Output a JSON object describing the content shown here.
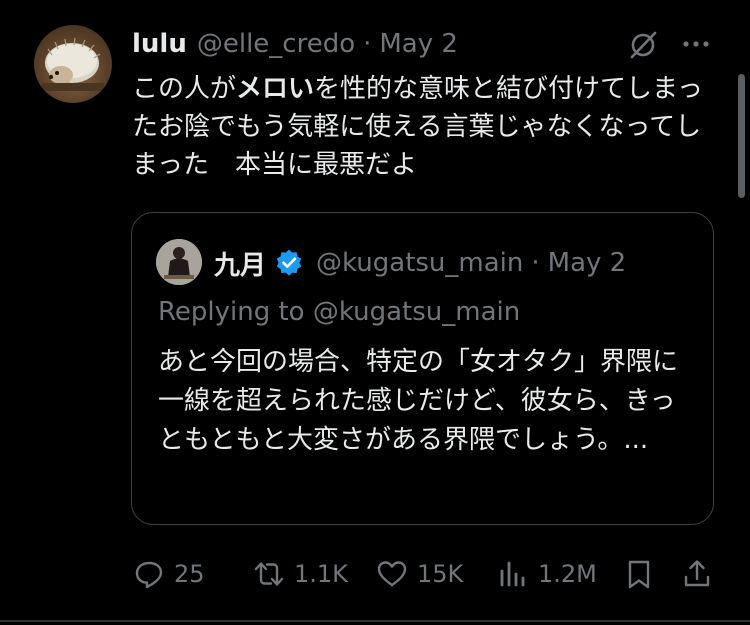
{
  "tweet": {
    "author_name": "lulu",
    "handle": "@elle_credo",
    "separator": "·",
    "date": "May 2",
    "text_parts": [
      "この人が",
      "メロい",
      "を性的な意味と結び付けてしまったお陰でもう気軽に使える言葉じゃなくなってしまった　本当に最悪だよ"
    ]
  },
  "quoted_tweet": {
    "author_name": "九月",
    "handle": "@kugatsu_main",
    "separator": "·",
    "date": "May 2",
    "replying_to": "Replying to @kugatsu_main",
    "text": "あと今回の場合、特定の「女オタク」界隈に一線を超えられた感じだけど、彼女ら、きっともともと大変さがある界隈でしょう。..."
  },
  "actions": {
    "replies": "25",
    "reposts": "1.1K",
    "likes": "15K",
    "views": "1.2M"
  },
  "icons": {
    "grok": "grok-icon",
    "more": "more-icon",
    "verified": "verified-icon",
    "reply": "reply-icon",
    "repost": "repost-icon",
    "like": "heart-icon",
    "views": "views-icon",
    "bookmark": "bookmark-icon",
    "share": "share-icon"
  },
  "colors": {
    "background": "#000000",
    "text": "#e7e9ea",
    "muted": "#71767b",
    "verified": "#1d9bf0",
    "border": "#3e4144"
  }
}
